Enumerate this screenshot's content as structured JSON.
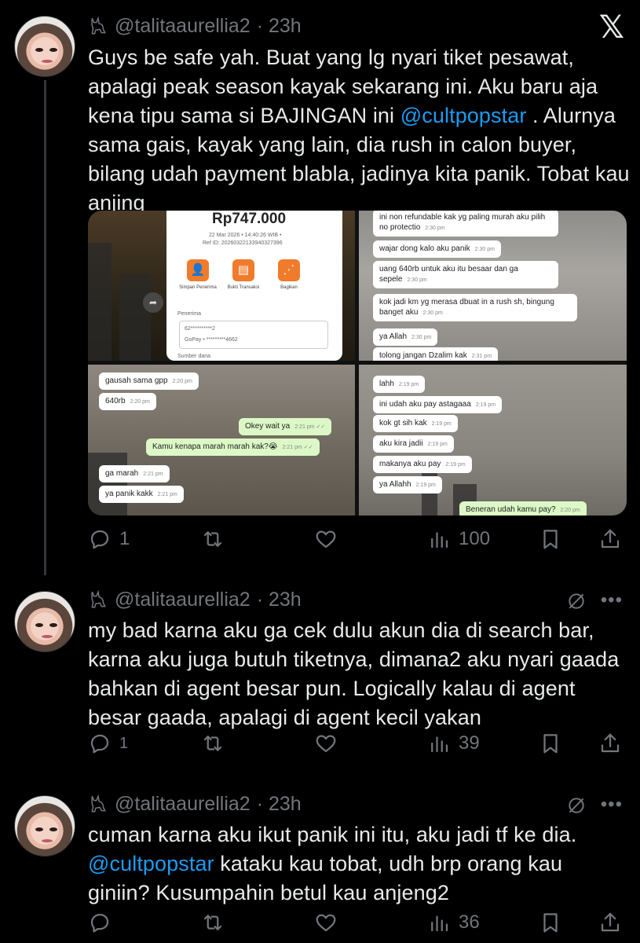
{
  "tweets": [
    {
      "handle": "@talitaaurellia2",
      "time": "· 23h",
      "text_parts": [
        "Guys be safe yah. Buat yang lg nyari tiket pesawat, apalagi peak season kayak sekarang ini. Aku baru aja kena tipu sama si BAJINGAN ini ",
        "@cultpopstar",
        " . Alurnya sama gais, kayak yang lain, dia rush in calon buyer, bilang udah payment blabla, jadinya kita panik. Tobat kau anjing"
      ],
      "replies": "1",
      "views": "100"
    },
    {
      "handle": "@talitaaurellia2",
      "time": "· 23h",
      "text": "my bad karna aku ga cek dulu akun dia di search bar, karna aku juga butuh tiketnya, dimana2 aku nyari gaada bahkan di agent besar pun. Logically kalau di agent besar gaada, apalagi di agent kecil yakan",
      "replies": "1",
      "views": "39"
    },
    {
      "handle": "@talitaaurellia2",
      "time": "· 23h",
      "text_parts": [
        "cuman karna aku ikut panik ini itu, aku jadi tf ke dia. ",
        "@cultpopstar",
        " kataku kau tobat, udh brp orang kau giniin? Kusumpahin betul kau anjeng2"
      ],
      "replies": "",
      "views": "36"
    }
  ],
  "media": {
    "receipt": {
      "amount": "Rp747.000",
      "date": "22 Mar 2026 • 14:40:26 WIB •",
      "ref": "Ref ID: 2026032213394032739​6",
      "btn1": "Simpan Penerima",
      "btn2": "Bukti Transaksi",
      "btn3": "Bagikan",
      "penerima": "Penerima",
      "acct1": "62**********2",
      "acct2": "GoPay • *********4662",
      "sumber": "Sumber dana"
    },
    "chat2": [
      {
        "text": "ini non refundable kak yg paling murah aku pilih no protectio",
        "time": "2:30 pm"
      },
      {
        "text": "wajar dong kalo aku panik",
        "time": "2:30 pm"
      },
      {
        "text": "uang 640rb untuk aku itu besaar dan ga sepele",
        "time": "2:30 pm"
      },
      {
        "text": "kok jadi km yg merasa dbuat in a rush sh, bingung banget aku",
        "time": "2:30 pm"
      },
      {
        "text": "ya Allah",
        "time": "2:30 pm"
      },
      {
        "text": "tolong jangan Dzalim kak",
        "time": "2:31 pm"
      }
    ],
    "chat3": [
      {
        "text": "gausah sama gpp",
        "time": "2:20 pm",
        "out": false
      },
      {
        "text": "640rb",
        "time": "2:20 pm",
        "out": false
      },
      {
        "text": "Okey wait ya",
        "time": "2:21 pm ✓✓",
        "out": true
      },
      {
        "text": "Kamu kenapa marah marah kak?😭",
        "time": "2:21 pm ✓✓",
        "out": true
      },
      {
        "text": "ga marah",
        "time": "2:21 pm",
        "out": false
      },
      {
        "text": "ya panik kakk",
        "time": "2:21 pm",
        "out": false
      }
    ],
    "chat4": [
      {
        "text": "lahh",
        "time": "2:19 pm",
        "out": false
      },
      {
        "text": "ini udah aku pay astagaaa",
        "time": "2:19 pm",
        "out": false
      },
      {
        "text": "kok gt sih kak",
        "time": "2:19 pm",
        "out": false
      },
      {
        "text": "aku kira jadii",
        "time": "2:19 pm",
        "out": false
      },
      {
        "text": "makanya aku pay",
        "time": "2:19 pm",
        "out": false
      },
      {
        "text": "ya Allahh",
        "time": "2:19 pm",
        "out": false
      },
      {
        "text": "Beneran udah kamu pay?",
        "time": "2:20 pm",
        "out": true
      }
    ]
  },
  "icons": {
    "reply": "reply-icon",
    "retweet": "retweet-icon",
    "like": "like-icon",
    "views": "views-icon",
    "bookmark": "bookmark-icon",
    "share": "share-icon",
    "x_logo": "𝕏"
  },
  "colors": {
    "background": "#000000",
    "text": "#e7e9ea",
    "muted": "#71767b",
    "link": "#1d9bf0"
  }
}
